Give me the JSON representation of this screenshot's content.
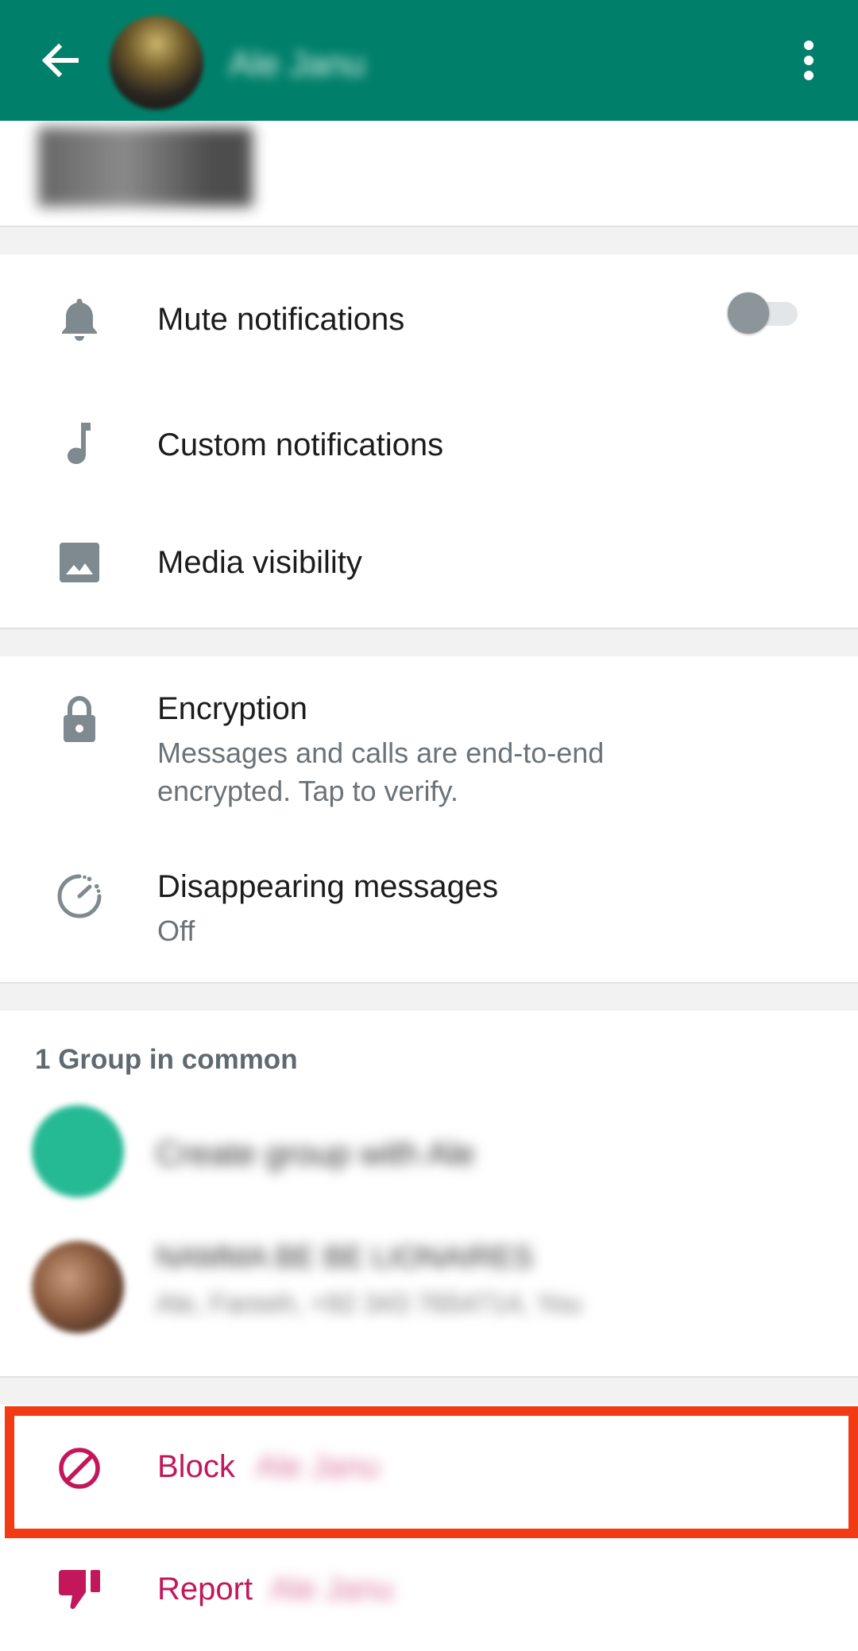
{
  "header": {
    "contact_name": "Ale Janu",
    "back_icon": "arrow-back-icon",
    "menu_icon": "more-vert-icon",
    "background_color": "#00806a"
  },
  "settings": {
    "mute_notifications": {
      "label": "Mute notifications",
      "icon": "bell-icon",
      "enabled": false
    },
    "custom_notifications": {
      "label": "Custom notifications",
      "icon": "music-note-icon"
    },
    "media_visibility": {
      "label": "Media visibility",
      "icon": "image-icon"
    }
  },
  "privacy": {
    "encryption": {
      "label": "Encryption",
      "line1": "Messages and calls are end-to-end",
      "line2": "encrypted. Tap to verify.",
      "icon": "lock-icon"
    },
    "disappearing": {
      "label": "Disappearing messages",
      "value": "Off",
      "icon": "timer-icon"
    }
  },
  "groups": {
    "title": "1 Group in common",
    "items": [
      {
        "name": "Create group with Ale",
        "avatar_color": "#25b994"
      },
      {
        "name": "NAMMA BE BE LIONAIRES",
        "members": "Ale, Fareeh, +92 343 7654714, You"
      }
    ]
  },
  "actions": {
    "block_label": "Block",
    "block_name": "Ale Janu",
    "report_label": "Report",
    "report_name": "Ale Janu",
    "danger_color": "#c2185b",
    "highlight_color": "#f23a14"
  }
}
